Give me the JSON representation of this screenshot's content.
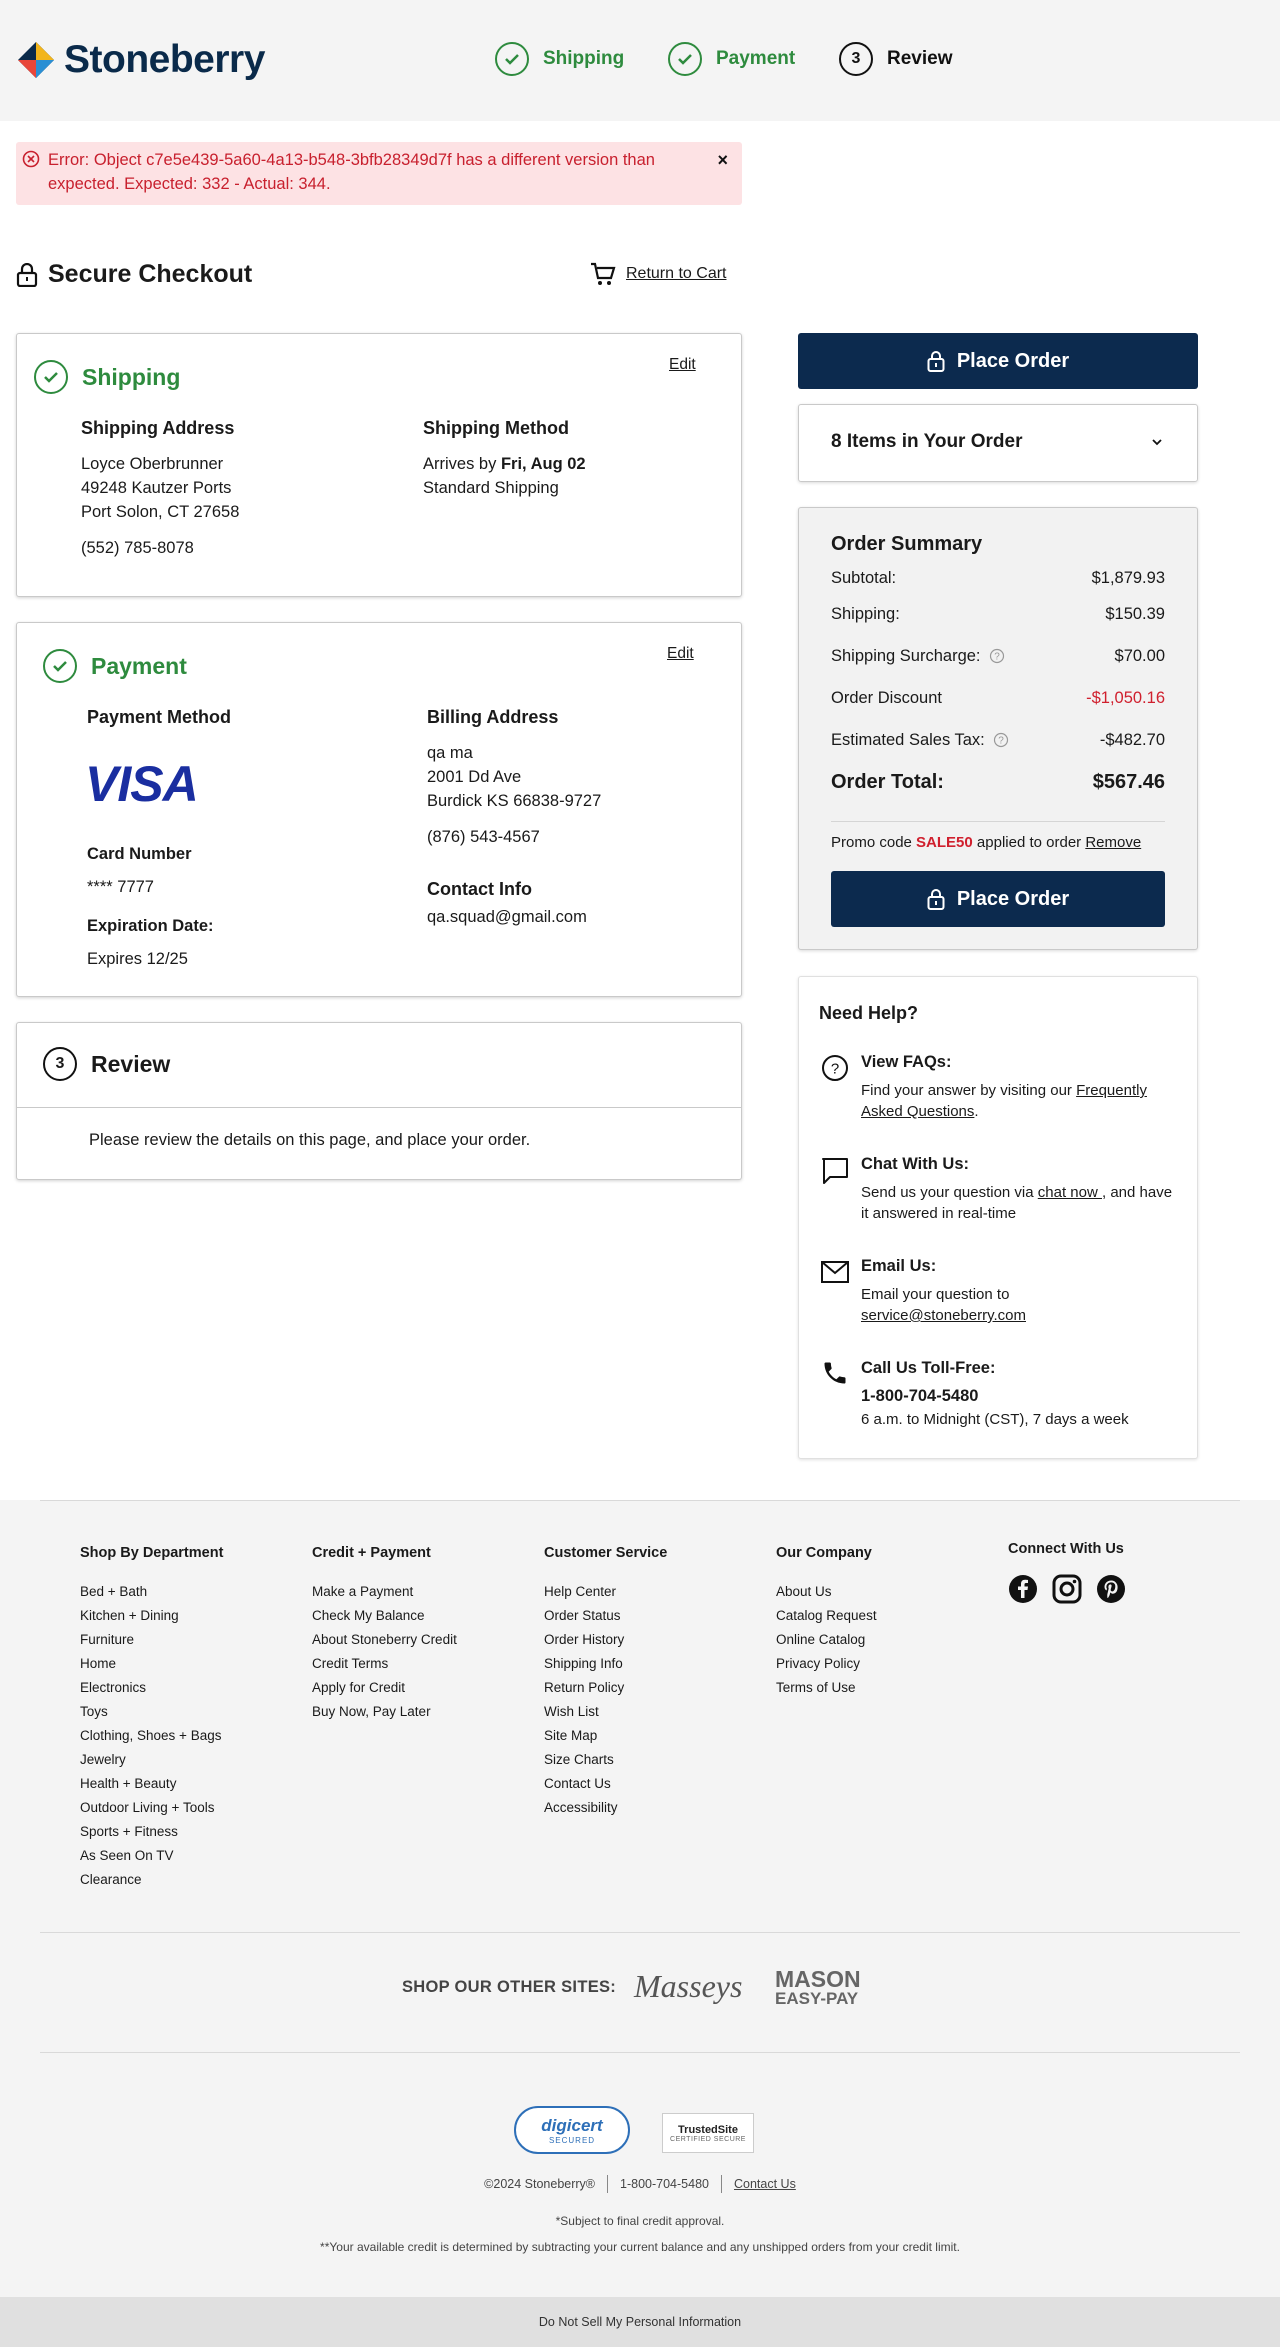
{
  "brand": {
    "name": "Stoneberry"
  },
  "steps": [
    {
      "label": "Shipping"
    },
    {
      "label": "Payment"
    },
    {
      "number": "3",
      "label": "Review"
    }
  ],
  "error": {
    "text": "Error: Object c7e5e439-5a60-4a13-b548-3bfb28349d7f has a different version than expected. Expected: 332 - Actual: 344.",
    "close": "×"
  },
  "checkout": {
    "title": "Secure Checkout",
    "return_label": "Return to Cart"
  },
  "shipping": {
    "title": "Shipping",
    "edit": "Edit",
    "address_heading": "Shipping Address",
    "name": "Loyce Oberbrunner",
    "street": "49248 Kautzer Ports",
    "city": "Port Solon, CT 27658",
    "phone": "(552) 785-8078",
    "method_heading": "Shipping Method",
    "arrives_prefix": "Arrives by ",
    "arrives_date": "Fri, Aug 02",
    "method": "Standard Shipping"
  },
  "payment": {
    "title": "Payment",
    "edit": "Edit",
    "method_heading": "Payment Method",
    "card_brand": "VISA",
    "card_number_heading": "Card Number",
    "card_number": "**** 7777",
    "exp_heading": "Expiration Date:",
    "exp": "Expires 12/25",
    "billing_heading": "Billing Address",
    "billing_name": "qa ma",
    "billing_street": "2001 Dd Ave",
    "billing_city": "Burdick KS 66838-9727",
    "billing_phone": "(876) 543-4567",
    "contact_heading": "Contact Info",
    "email": "qa.squad@gmail.com"
  },
  "review": {
    "number": "3",
    "title": "Review",
    "text": "Please review the details on this page, and place your order."
  },
  "order": {
    "place_label": "Place Order",
    "items_label": "8 Items in Your Order",
    "summary_title": "Order Summary",
    "rows": [
      {
        "label": "Subtotal:",
        "value": "$1,879.93"
      },
      {
        "label": "Shipping:",
        "value": "$150.39"
      },
      {
        "label": "Shipping Surcharge:",
        "value": "$70.00"
      },
      {
        "label": "Order Discount",
        "value": "-$1,050.16"
      },
      {
        "label": "Estimated Sales Tax:",
        "value": "-$482.70"
      }
    ],
    "total_label": "Order Total:",
    "total_value": "$567.46",
    "promo_prefix": "Promo code ",
    "promo_code": "SALE50",
    "promo_suffix": " applied to order ",
    "promo_remove": "Remove",
    "discount_color": "#d0202e"
  },
  "help": {
    "title": "Need Help?",
    "faq_title": "View FAQs:",
    "faq_text": "Find your answer by visiting our ",
    "faq_link": "Frequently Asked Questions",
    "faq_end": ".",
    "chat_title": "Chat With Us:",
    "chat_text": "Send us your question via ",
    "chat_link": "chat now ",
    "chat_end": ", and have it answered in real-time",
    "email_title": "Email Us:",
    "email_text": "Email your question to ",
    "email_link": "service@stoneberry.com",
    "call_title": "Call Us Toll-Free:",
    "call_number": "1-800-704-5480",
    "call_hours": "6 a.m. to Midnight (CST), 7 days a week"
  },
  "footer": {
    "columns": [
      {
        "heading": "Shop By Department",
        "links": [
          "Bed + Bath",
          "Kitchen + Dining",
          "Furniture",
          "Home",
          "Electronics",
          "Toys",
          "Clothing, Shoes + Bags",
          "Jewelry",
          "Health + Beauty",
          "Outdoor Living + Tools",
          "Sports + Fitness",
          "As Seen On TV",
          "Clearance"
        ]
      },
      {
        "heading": "Credit + Payment",
        "links": [
          "Make a Payment",
          "Check My Balance",
          "About Stoneberry Credit",
          "Credit Terms",
          "Apply for Credit",
          "Buy Now, Pay Later"
        ]
      },
      {
        "heading": "Customer Service",
        "links": [
          "Help Center",
          "Order Status",
          "Order History",
          "Shipping Info",
          "Return Policy",
          "Wish List",
          "Site Map",
          "Size Charts",
          "Contact Us",
          "Accessibility"
        ]
      },
      {
        "heading": "Our Company",
        "links": [
          "About Us",
          "Catalog Request",
          "Online Catalog",
          "Privacy Policy",
          "Terms of Use"
        ]
      }
    ],
    "connect": "Connect With Us",
    "other_sites": "SHOP OUR OTHER SITES:",
    "masseys": "Masseys",
    "mason_line1": "MASON",
    "mason_line2": "EASY-PAY",
    "digicert": "digicert",
    "digicert_sub": "SECURED",
    "trusted": "TrustedSite",
    "trusted_sub": "CERTIFIED SECURE",
    "copyright": "©2024 Stoneberry®",
    "phone": "1-800-704-5480",
    "contact": "Contact Us",
    "note1": "*Subject to final credit approval.",
    "note2": "**Your available credit is determined by subtracting your current balance and any unshipped orders from your credit limit.",
    "dnsmpi": "Do Not Sell My Personal Information"
  }
}
